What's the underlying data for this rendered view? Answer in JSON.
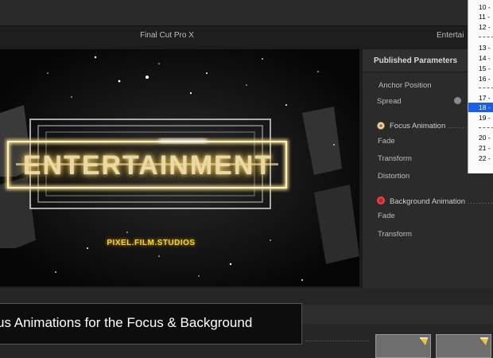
{
  "window": {
    "app_title": "Final Cut Pro X",
    "inspector_title": "Entertai"
  },
  "viewer": {
    "title_text": "ENTERTAINMENT",
    "brand_text": "PIXEL.FILM.STUDIOS"
  },
  "inspector": {
    "header": "Published Parameters",
    "anchor_position": "Anchor Position",
    "spread": "Spread",
    "focus_group": "Focus Animation",
    "focus_fade": "Fade",
    "focus_transform": "Transform",
    "focus_distortion": "Distortion",
    "background_group": "Background Animation",
    "bg_fade": "Fade",
    "bg_transform": "Transform",
    "dots_short": "........",
    "dots_long": "........."
  },
  "dropdown": {
    "items": [
      "10 -",
      "11 -",
      "12 -",
      "13 -",
      "14 -",
      "15 -",
      "16 -",
      "17 -",
      "18 -",
      "19 -",
      "20 -",
      "21 -",
      "22 -"
    ],
    "selected": "18 -"
  },
  "caption": {
    "text": "us Animations for the Focus & Background"
  },
  "colors": {
    "accent_selection": "#1a5ee3",
    "title_glow": "#ffe27a",
    "brand_yellow": "#f5d13c"
  }
}
